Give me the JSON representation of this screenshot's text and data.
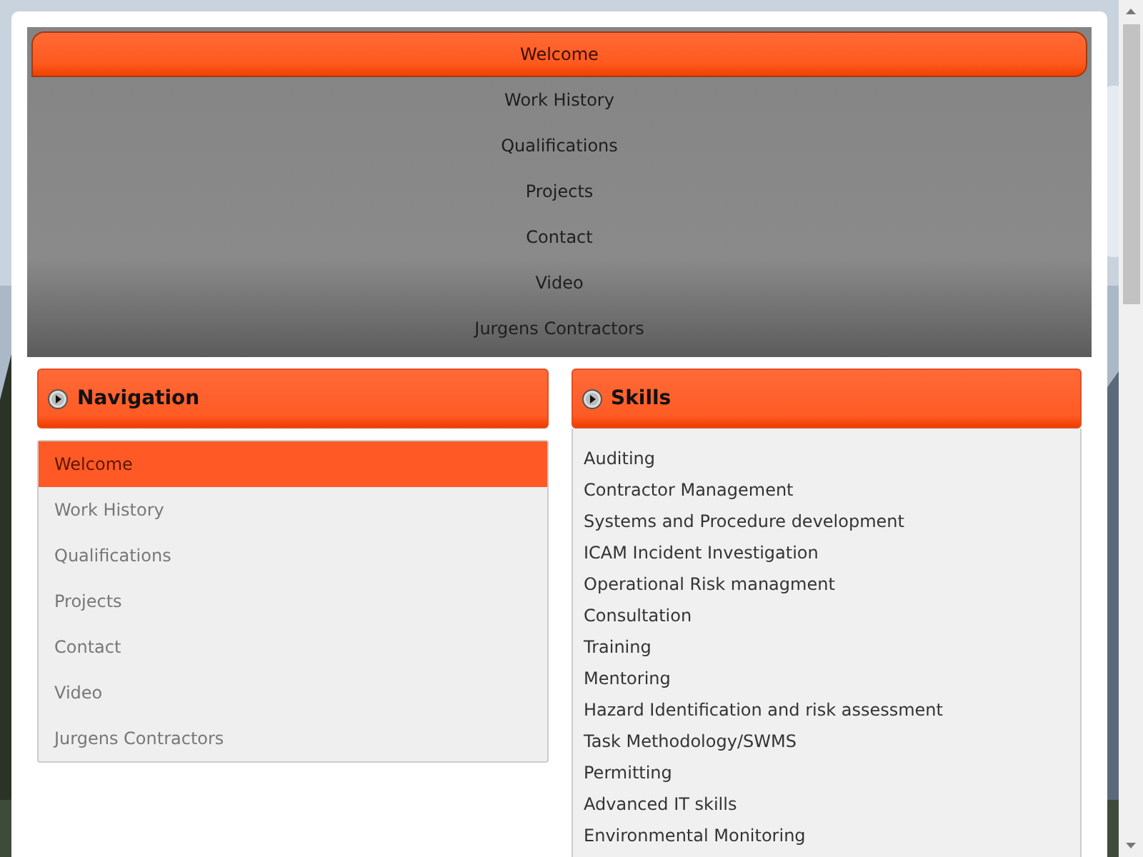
{
  "top_menu": [
    {
      "label": "Welcome",
      "selected": true
    },
    {
      "label": "Work History",
      "selected": false
    },
    {
      "label": "Qualifications",
      "selected": false
    },
    {
      "label": "Projects",
      "selected": false
    },
    {
      "label": "Contact",
      "selected": false
    },
    {
      "label": "Video",
      "selected": false
    },
    {
      "label": "Jurgens Contractors",
      "selected": false
    }
  ],
  "navigation": {
    "title": "Navigation",
    "items": [
      {
        "label": "Welcome",
        "selected": true
      },
      {
        "label": "Work History",
        "selected": false
      },
      {
        "label": "Qualifications",
        "selected": false
      },
      {
        "label": "Projects",
        "selected": false
      },
      {
        "label": "Contact",
        "selected": false
      },
      {
        "label": "Video",
        "selected": false
      },
      {
        "label": "Jurgens Contractors",
        "selected": false
      }
    ]
  },
  "skills": {
    "title": "Skills",
    "items": [
      "Auditing",
      "Contractor Management",
      "Systems and Procedure development",
      "ICAM Incident Investigation",
      "Operational Risk managment",
      "Consultation",
      "Training",
      "Mentoring",
      "Hazard Identification and risk assessment",
      "Task Methodology/SWMS",
      "Permitting",
      "Advanced IT skills",
      "Environmental Monitoring"
    ]
  }
}
